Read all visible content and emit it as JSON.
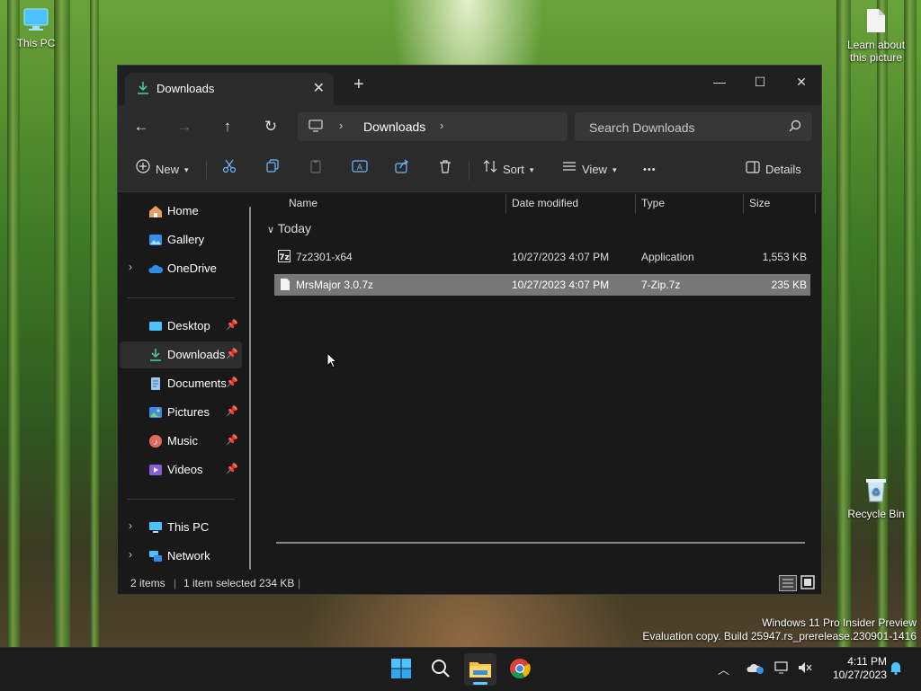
{
  "desktop": {
    "icons": [
      {
        "label": "This PC"
      },
      {
        "label": "Learn about this picture"
      },
      {
        "label": "Recycle Bin"
      }
    ],
    "watermark_line1": "Windows 11 Pro Insider Preview",
    "watermark_line2": "Evaluation copy. Build 25947.rs_prerelease.230901-1416"
  },
  "window": {
    "tab_title": "Downloads",
    "new_tab_label": "+",
    "breadcrumb": [
      "Downloads"
    ],
    "search_placeholder": "Search Downloads"
  },
  "toolbar": {
    "new_label": "New",
    "sort_label": "Sort",
    "view_label": "View",
    "more_label": "•••",
    "details_label": "Details"
  },
  "sidebar": {
    "items": [
      {
        "label": "Home"
      },
      {
        "label": "Gallery"
      },
      {
        "label": "OneDrive"
      },
      {
        "label": "Desktop"
      },
      {
        "label": "Downloads"
      },
      {
        "label": "Documents"
      },
      {
        "label": "Pictures"
      },
      {
        "label": "Music"
      },
      {
        "label": "Videos"
      },
      {
        "label": "This PC"
      },
      {
        "label": "Network"
      }
    ]
  },
  "files": {
    "columns": [
      "Name",
      "Date modified",
      "Type",
      "Size"
    ],
    "group": "Today",
    "rows": [
      {
        "name": "7z2301-x64",
        "date": "10/27/2023 4:07 PM",
        "type": "Application",
        "size": "1,553 KB"
      },
      {
        "name": "MrsMajor 3.0.7z",
        "date": "10/27/2023 4:07 PM",
        "type": "7-Zip.7z",
        "size": "235 KB"
      }
    ]
  },
  "status": {
    "items_count": "2 items",
    "selection": "1 item selected  234 KB",
    "sep": "|"
  },
  "taskbar": {
    "time": "4:11 PM",
    "date": "10/27/2023"
  },
  "colors": {
    "accent": "#60cdff",
    "download_green": "#4cc2a0",
    "selection": "#777777"
  }
}
